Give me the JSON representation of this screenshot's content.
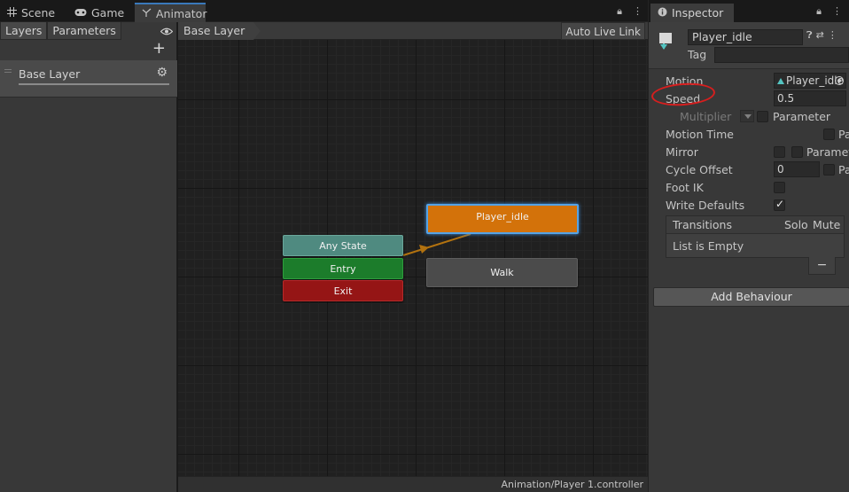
{
  "tabs": [
    {
      "label": "Scene",
      "icon": "grid-icon"
    },
    {
      "label": "Game",
      "icon": "gamepad-icon"
    },
    {
      "label": "Animator",
      "icon": "animator-icon",
      "active": true
    }
  ],
  "animator": {
    "left_tabs": [
      "Layers",
      "Parameters"
    ],
    "layer_name": "Base Layer",
    "breadcrumb": "Base Layer",
    "auto_live_link": "Auto Live Link",
    "footer_path": "Animation/Player 1.controller",
    "nodes": {
      "any_state": "Any State",
      "entry": "Entry",
      "exit": "Exit",
      "player_idle": "Player_idle",
      "walk": "Walk"
    },
    "colors": {
      "any_state": "#4f8a80",
      "entry": "#1c7c2b",
      "exit": "#951515",
      "default_state": "#d3720a",
      "selection": "#55a3e6",
      "transition": "#b2720f"
    }
  },
  "inspector": {
    "tab_label": "Inspector",
    "state_name": "Player_idle",
    "tag_label": "Tag",
    "tag_value": "",
    "motion_label": "Motion",
    "motion_value": "Player_idle",
    "speed_label": "Speed",
    "speed_value": "0.5",
    "multiplier_label": "Multiplier",
    "multiplier_param_label": "Parameter",
    "motion_time_label": "Motion Time",
    "motion_time_param_label": "Parameter",
    "mirror_label": "Mirror",
    "mirror_param_label": "Parameter",
    "cycle_offset_label": "Cycle Offset",
    "cycle_offset_value": "0",
    "cycle_offset_param_label": "Parameter",
    "foot_ik_label": "Foot IK",
    "foot_ik_checked": false,
    "write_defaults_label": "Write Defaults",
    "write_defaults_checked": true,
    "transitions_header": "Transitions",
    "solo_label": "Solo",
    "mute_label": "Mute",
    "transitions_empty": "List is Empty",
    "remove_label": "−",
    "add_behaviour": "Add Behaviour",
    "annotation_color": "#d81e1e"
  }
}
